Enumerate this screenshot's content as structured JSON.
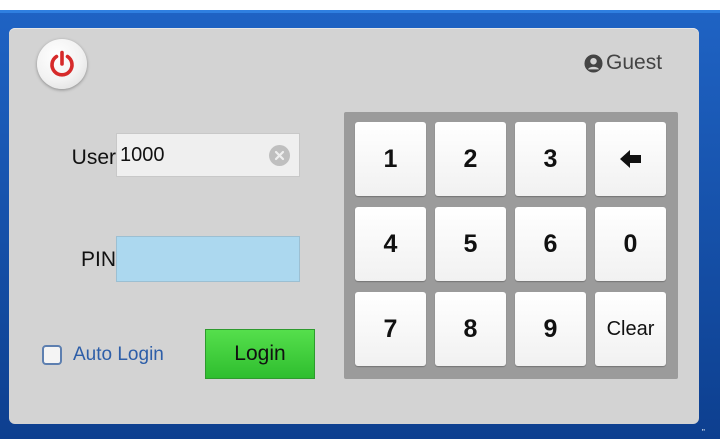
{
  "header": {
    "power_icon": "power-icon",
    "guest_icon": "user-circle-icon",
    "guest_label": "Guest"
  },
  "form": {
    "user_label": "User",
    "user_value": "1000",
    "clear_icon": "clear-circle-x-icon",
    "pin_label": "PIN",
    "pin_value": "",
    "auto_login_label": "Auto Login",
    "auto_login_checked": false,
    "login_label": "Login"
  },
  "keypad": {
    "keys": [
      "1",
      "2",
      "3",
      "backspace",
      "4",
      "5",
      "6",
      "0",
      "7",
      "8",
      "9",
      "Clear"
    ],
    "backspace_icon": "left-arrow-icon"
  },
  "colors": {
    "frame": "#1a57b5",
    "panel": "#d3d3d3",
    "power_red": "#d62a2a",
    "pin_field": "#acd8ef",
    "login_green": "#3ccc3a",
    "link_blue": "#2d5ea8"
  }
}
